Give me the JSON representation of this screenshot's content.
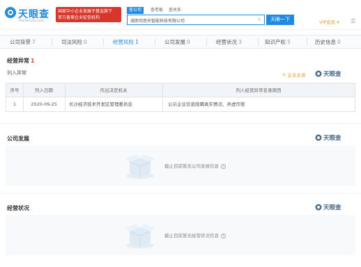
{
  "header": {
    "logo_text": "天眼查",
    "logo_subtext": "TianYanCha.com",
    "badge_line1": "国家中小企业发展子基金旗下",
    "badge_line2": "官方备案企业征信机构",
    "search_tabs": [
      "查公司",
      "查老板",
      "查关系"
    ],
    "search_value": "湖南司南天智能科技有限公司",
    "search_button": "天眼一下",
    "vip_label": "VIP会员",
    "accent_color": "#1f8ae3"
  },
  "tabs": [
    {
      "label": "公司背景",
      "count": "7"
    },
    {
      "label": "司法风险",
      "count": "0"
    },
    {
      "label": "经营风险",
      "count": "1"
    },
    {
      "label": "公司发展",
      "count": "0"
    },
    {
      "label": "经营状况",
      "count": "3"
    },
    {
      "label": "知识产权",
      "count": "5"
    },
    {
      "label": "历史信息",
      "count": "0"
    }
  ],
  "abnormal": {
    "title": "经营异常",
    "count": "1",
    "subtitle": "列入异常",
    "helper": "企业主说",
    "watermark": "天眼查",
    "columns": [
      "序号",
      "列入日期",
      "作出决定机关",
      "列入经营异常名录原因"
    ],
    "rows": [
      [
        "1",
        "2020-09-25",
        "长沙经济技术开发区管理委员会",
        "公示企业信息隐瞒真实情况、弄虚作假"
      ]
    ]
  },
  "development": {
    "title": "公司发展",
    "watermark": "天眼查",
    "empty_text": "截止目前暂无公司发展信息"
  },
  "operations": {
    "title": "经营状况",
    "watermark": "天眼查",
    "empty_text": "截止目前暂无经营状况信息"
  }
}
